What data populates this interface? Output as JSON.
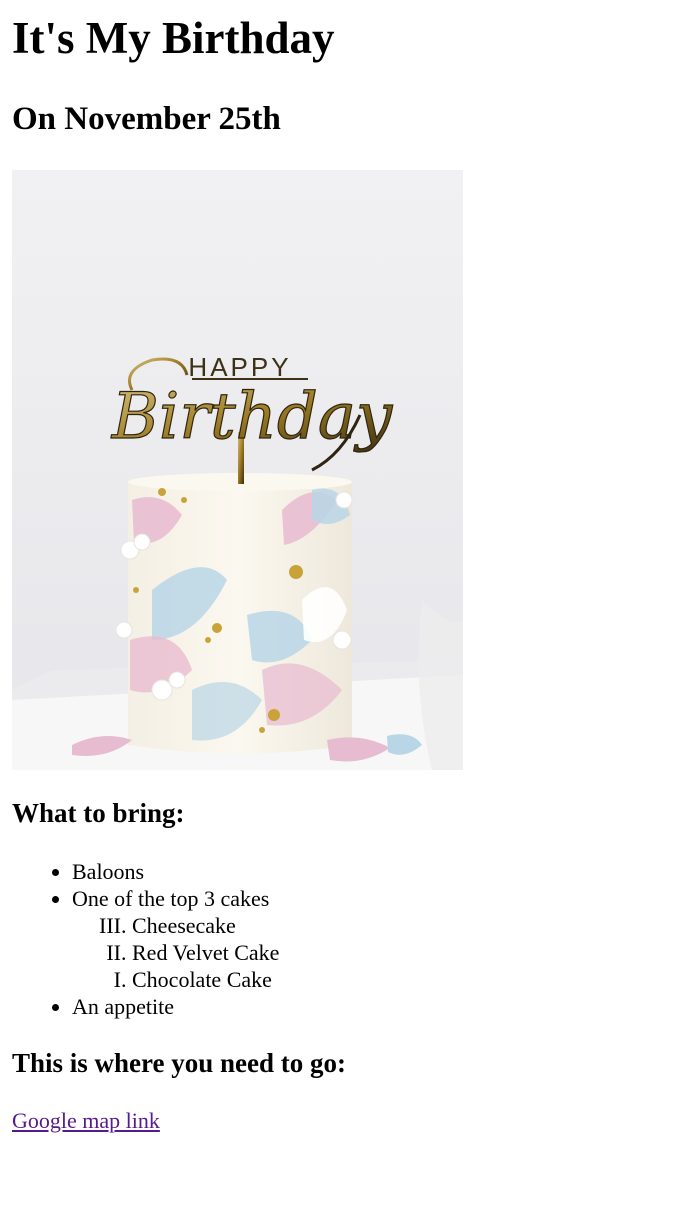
{
  "page": {
    "title": "It's My Birthday",
    "subtitle": "On November 25th"
  },
  "image": {
    "topper_text_top": "HAPPY",
    "topper_text_script": "Birthday",
    "icon": "birthday-cake-photo"
  },
  "bring": {
    "heading": "What to bring:",
    "items": [
      "Baloons",
      "One of the top 3 cakes",
      "An appetite"
    ],
    "cakes": [
      "Cheesecake",
      "Red Velvet Cake",
      "Chocolate Cake"
    ],
    "cake_numbers": [
      3,
      2,
      1
    ]
  },
  "directions": {
    "heading": "This is where you need to go:",
    "link_label": "Google map link"
  },
  "colors": {
    "link_visited": "#551a8b",
    "cake_pink": "#e8bcd0",
    "cake_blue": "#b9d6e6",
    "topper_gold": "#b8962e"
  }
}
